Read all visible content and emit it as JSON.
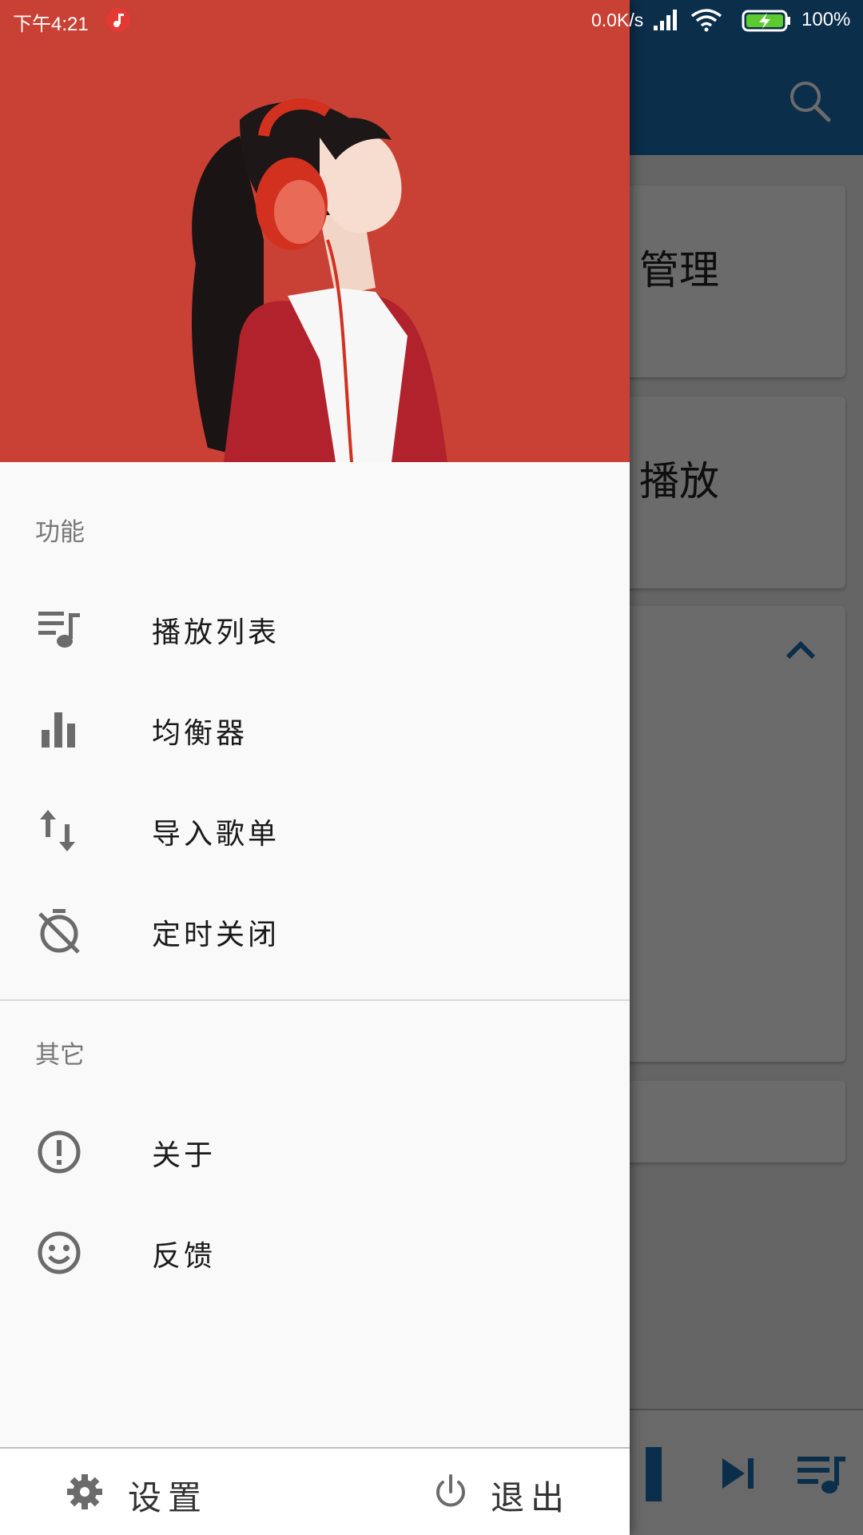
{
  "status_bar": {
    "time": "下午4:21",
    "network_speed": "0.0K/s",
    "battery_percent": "100%"
  },
  "background": {
    "card_1_title": "管理",
    "card_2_title": "播放"
  },
  "drawer": {
    "section_functions": "功能",
    "items": [
      {
        "label": "播放列表",
        "icon": "playlist-icon"
      },
      {
        "label": "均衡器",
        "icon": "equalizer-icon"
      },
      {
        "label": "导入歌单",
        "icon": "import-icon"
      },
      {
        "label": "定时关闭",
        "icon": "timer-off-icon"
      }
    ],
    "section_other": "其它",
    "other_items": [
      {
        "label": "关于",
        "icon": "info-icon"
      },
      {
        "label": "反馈",
        "icon": "smiley-icon"
      }
    ],
    "footer": {
      "settings_label": "设置",
      "exit_label": "退出"
    }
  },
  "colors": {
    "drawer_header": "#c94134",
    "toolbar": "#1c6fb4",
    "icon_gray": "#6b6b6b"
  }
}
